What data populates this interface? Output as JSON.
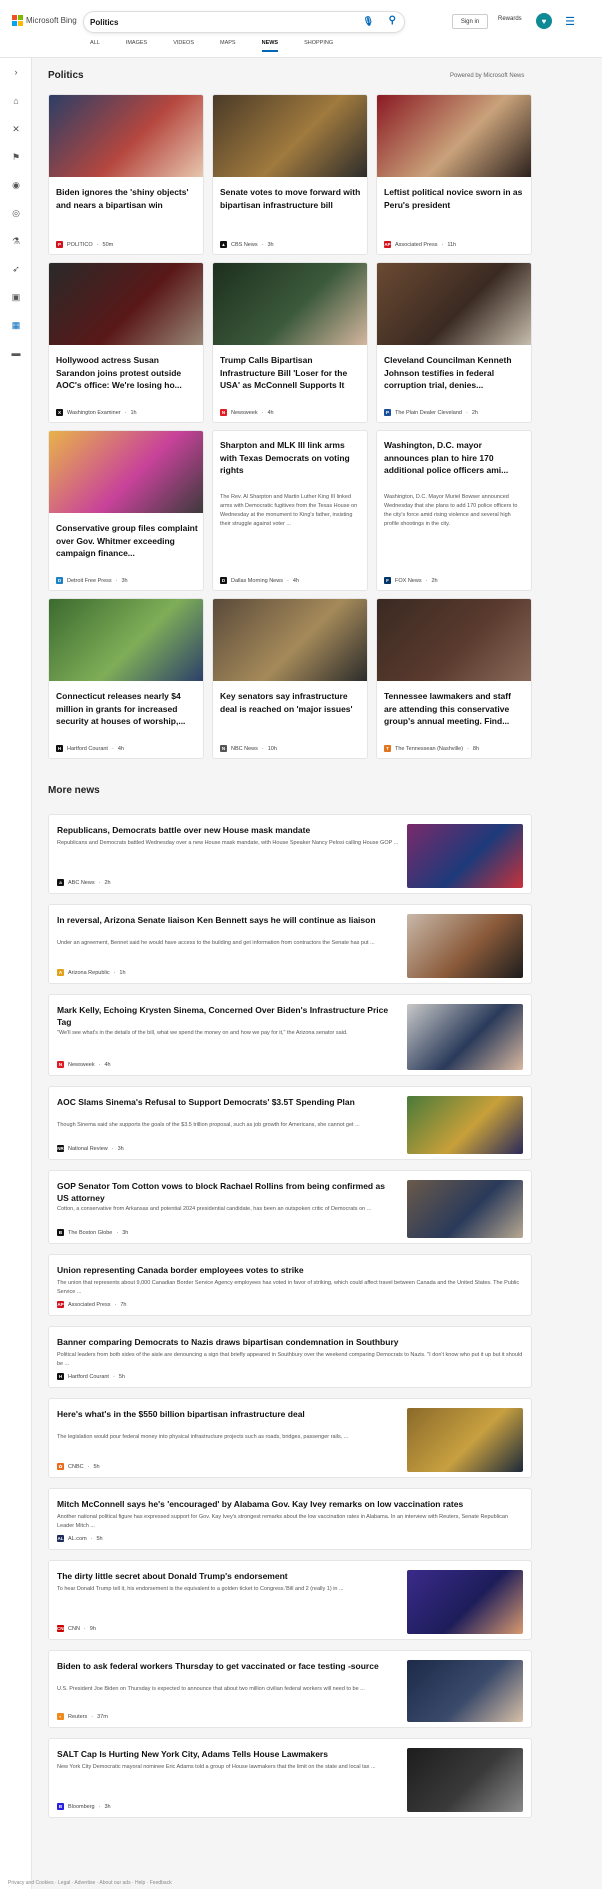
{
  "header": {
    "logo_text": "Microsoft Bing",
    "search_value": "Politics",
    "signin_label": "Sign in",
    "rewards_label": "Rewards",
    "tabs": [
      {
        "label": "ALL",
        "active": false
      },
      {
        "label": "IMAGES",
        "active": false
      },
      {
        "label": "VIDEOS",
        "active": false
      },
      {
        "label": "MAPS",
        "active": false
      },
      {
        "label": "NEWS",
        "active": true
      },
      {
        "label": "SHOPPING",
        "active": false
      }
    ]
  },
  "sidebar": {
    "items": [
      {
        "icon": "chevron-right-icon",
        "glyph": "›"
      },
      {
        "icon": "home-icon",
        "glyph": "⌂"
      },
      {
        "icon": "tools-icon",
        "glyph": "✕"
      },
      {
        "icon": "flag-icon",
        "glyph": "⚑"
      },
      {
        "icon": "location-icon",
        "glyph": "◉"
      },
      {
        "icon": "globe-icon",
        "glyph": "◎"
      },
      {
        "icon": "science-icon",
        "glyph": "⚗"
      },
      {
        "icon": "rocket-icon",
        "glyph": "➶"
      },
      {
        "icon": "video-icon",
        "glyph": "▣"
      },
      {
        "icon": "politics-icon",
        "glyph": "▦"
      },
      {
        "icon": "card-icon",
        "glyph": "▬"
      }
    ]
  },
  "top_section": {
    "title": "Politics",
    "powered_by": "Powered by Microsoft News",
    "cards": [
      {
        "title": "Biden ignores the 'shiny objects' and nears a bipartisan win",
        "source": "POLITICO",
        "time": "50m",
        "fav": "P",
        "favcolor": "#d4121d",
        "img": [
          "#2c3e66",
          "#b5473f",
          "#e8c9b0"
        ]
      },
      {
        "title": "Senate votes to move forward with bipartisan infrastructure bill",
        "source": "CBS News",
        "time": "3h",
        "fav": "▲",
        "favcolor": "#111111",
        "img": [
          "#4a3a28",
          "#a07a3e",
          "#2b2b2b"
        ]
      },
      {
        "title": "Leftist political novice sworn in as Peru's president",
        "source": "Associated Press",
        "time": "11h",
        "fav": "AP",
        "favcolor": "#d4121d",
        "img": [
          "#8b1a24",
          "#c9a27a",
          "#2a1f1c"
        ]
      },
      {
        "title": "Hollywood actress Susan Sarandon joins protest outside AOC's office: We're losing ho...",
        "source": "Washington Examiner",
        "time": "1h",
        "fav": "X",
        "favcolor": "#111111",
        "img": [
          "#2a2a2a",
          "#5a1818",
          "#9a8a7a"
        ]
      },
      {
        "title": "Trump Calls Bipartisan Infrastructure Bill 'Loser for the USA' as McConnell Supports It",
        "source": "Newsweek",
        "time": "4h",
        "fav": "N",
        "favcolor": "#e21b23",
        "img": [
          "#1d2f1d",
          "#3c5a3c",
          "#d7b8a0"
        ]
      },
      {
        "title": "Cleveland Councilman Kenneth Johnson testifies in federal corruption trial, denies...",
        "source": "The Plain Dealer Cleveland",
        "time": "2h",
        "fav": "P",
        "favcolor": "#1a4f9c",
        "img": [
          "#6b4a32",
          "#3a2a22",
          "#c9c0b0"
        ]
      },
      {
        "title": "Conservative group files complaint over Gov. Whitmer exceeding campaign finance...",
        "source": "Detroit Free Press",
        "time": "3h",
        "fav": "D",
        "favcolor": "#1b80c4",
        "img": [
          "#e8b34a",
          "#c8429a",
          "#3a3a3a"
        ]
      },
      {
        "title": "Sharpton and MLK III link arms with Texas Democrats on voting rights",
        "snippet": "The Rev. Al Sharpton and Martin Luther King III linked arms with Democratic fugitives from the Texas House on Wednesday at the monument to King's father, insisting their struggle against voter ...",
        "source": "Dallas Morning News",
        "time": "4h",
        "fav": "D",
        "favcolor": "#111111"
      },
      {
        "title": "Washington, D.C. mayor announces plan to hire 170 additional police officers ami...",
        "snippet": "Washington, D.C. Mayor Muriel Bowser announced Wednesday that she plans to add 170 police officers to the city's force amid rising violence and several high profile shootings in the city.",
        "source": "FOX News",
        "time": "2h",
        "fav": "F",
        "favcolor": "#003366"
      },
      {
        "title": "Connecticut releases nearly $4 million in grants for increased security at houses of worship,...",
        "source": "Hartford Courant",
        "time": "4h",
        "fav": "H",
        "favcolor": "#111111",
        "img": [
          "#3b6a2f",
          "#7fae58",
          "#2b3e6a"
        ]
      },
      {
        "title": "Key senators say infrastructure deal is reached on 'major issues'",
        "source": "NBC News",
        "time": "10h",
        "fav": "N",
        "favcolor": "#555555",
        "img": [
          "#5a4a3a",
          "#a58a5a",
          "#2a2a2a"
        ]
      },
      {
        "title": "Tennessee lawmakers and staff are attending this conservative group's annual meeting. Find...",
        "source": "The Tennessean (Nashville)",
        "time": "8h",
        "fav": "T",
        "favcolor": "#e2741b",
        "img": [
          "#3a2a22",
          "#5a3a2e",
          "#8a6a5a"
        ]
      }
    ]
  },
  "more_news": {
    "title": "More news",
    "items": [
      {
        "title": "Republicans, Democrats battle over new House mask mandate",
        "snippet": "Republicans and Democrats battled Wednesday over a new House mask mandate, with House Speaker Nancy Pelosi calling House GOP ...",
        "source": "ABC News",
        "time": "2h",
        "fav": "a",
        "favcolor": "#111111",
        "img": [
          "#7a2a6a",
          "#1d3a7a",
          "#c8323a"
        ]
      },
      {
        "title": "In reversal, Arizona Senate liaison Ken Bennett says he will continue as liaison",
        "snippet": "Under an agreement, Bennet said he would have access to the building and get information from contractors the Senate has put ...",
        "source": "Arizona Republic",
        "time": "1h",
        "fav": "A",
        "favcolor": "#e2a01b",
        "img": [
          "#c8b8a8",
          "#8a5a3a",
          "#1d1d1d"
        ]
      },
      {
        "title": "Mark Kelly, Echoing Krysten Sinema, Concerned Over Biden's Infrastructure Price Tag",
        "snippet": "\"We'll see what's in the details of the bill, what we spend the money on and how we pay for it,\" the Arizona senator said.",
        "source": "Newsweek",
        "time": "4h",
        "fav": "N",
        "favcolor": "#e21b23",
        "img": [
          "#c8c8c8",
          "#2a3a5a",
          "#d8b8a0"
        ]
      },
      {
        "title": "AOC Slams Sinema's Refusal to Support Democrats' $3.5T Spending Plan",
        "snippet": "Though Sinema said she supports the goals of the $3.5 trillion proposal, such as job growth for Americans, she cannot get ...",
        "source": "National Review",
        "time": "3h",
        "fav": "NR",
        "favcolor": "#111111",
        "img": [
          "#4a7a3a",
          "#c8a03a",
          "#2a2a5a"
        ]
      },
      {
        "title": "GOP Senator Tom Cotton vows to block Rachael Rollins from being confirmed as US attorney",
        "snippet": "Cotton, a conservative from Arkansas and potential 2024 presidential candidate, has been an outspoken critic of Democrats on ...",
        "source": "The Boston Globe",
        "time": "3h",
        "fav": "B",
        "favcolor": "#111111",
        "img": [
          "#6a5a4a",
          "#2a3a5a",
          "#b8a890"
        ]
      },
      {
        "title": "Union representing Canada border employees votes to strike",
        "snippet": "The union that represents about 9,000 Canadian Border Service Agency employees has voted in favor of striking, which could affect travel between Canada and the United States. The Public Service ...",
        "source": "Associated Press",
        "time": "7h",
        "fav": "AP",
        "favcolor": "#d4121d"
      },
      {
        "title": "Banner comparing Democrats to Nazis draws bipartisan condemnation in Southbury",
        "snippet": "Political leaders from both sides of the aisle are denouncing a sign that briefly appeared in Southbury over the weekend comparing Democrats to Nazis. \"I don't know who put it up but it should be ...",
        "source": "Hartford Courant",
        "time": "5h",
        "fav": "H",
        "favcolor": "#111111"
      },
      {
        "title": "Here's what's in the $550 billion bipartisan infrastructure deal",
        "snippet": "The legislation would pour federal money into physical infrastructure projects such as roads, bridges, passenger rails, ...",
        "source": "CNBC",
        "time": "5h",
        "fav": "✿",
        "favcolor": "#ea6a1b",
        "img": [
          "#8a6a2a",
          "#c8a040",
          "#1d2a3a"
        ]
      },
      {
        "title": "Mitch McConnell says he's 'encouraged' by Alabama Gov. Kay Ivey remarks on low vaccination rates",
        "snippet": "Another national political figure has expressed support for Gov. Kay Ivey's strongest remarks about the low vaccination rates in Alabama. In an interview with Reuters, Senate Republican Leader Mitch ...",
        "source": "AL.com",
        "time": "5h",
        "fav": "AL",
        "favcolor": "#1d2a5a"
      },
      {
        "title": "The dirty little secret about Donald Trump's endorsement",
        "snippet": "To hear Donald Trump tell it, his endorsement is the equivalent to a golden ticket to Congress.'Bill and 2 (really 1) in ...",
        "source": "CNN",
        "time": "9h",
        "fav": "CNN",
        "favcolor": "#cc0000",
        "img": [
          "#3a2a8a",
          "#1d1d5a",
          "#d89a70"
        ]
      },
      {
        "title": "Biden to ask federal workers Thursday to get vaccinated or face testing -source",
        "snippet": "U.S. President Joe Biden on Thursday is expected to announce that about two million civilian federal workers will need to be ...",
        "source": "Reuters",
        "time": "37m",
        "fav": "◐",
        "favcolor": "#f08a1b",
        "img": [
          "#1d2a4a",
          "#3a4a6a",
          "#d8c0a8"
        ]
      },
      {
        "title": "SALT Cap Is Hurting New York City, Adams Tells House Lawmakers",
        "snippet": "New York City Democratic mayoral nominee Eric Adams told a group of House lawmakers that the limit on the state and local tax ...",
        "source": "Bloomberg",
        "time": "3h",
        "fav": "B",
        "favcolor": "#2a1ee0",
        "img": [
          "#1d1d1d",
          "#3a3a3a",
          "#8a8a8a"
        ]
      }
    ]
  },
  "footer": {
    "text": "Privacy and Cookies · Legal · Advertise · About our ads · Help · Feedback"
  }
}
